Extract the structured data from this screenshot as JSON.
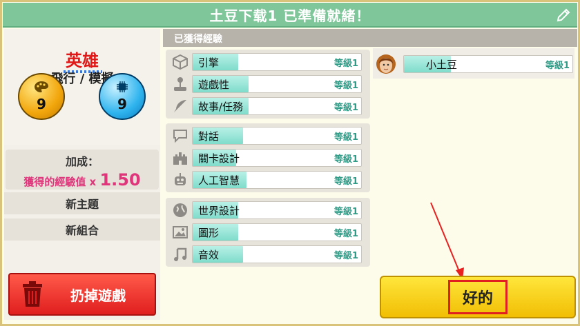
{
  "window": {
    "title": "土豆下载1 已準備就緒！"
  },
  "left": {
    "hero_text": "英雄",
    "genre": "飛行 / 模擬",
    "design_points": "9",
    "tech_points": "9",
    "bonus_label": "加成：",
    "bonus_text": "獲得的經驗值 x",
    "bonus_value": "1.50",
    "new_topic": "新主題",
    "new_combo": "新組合",
    "trash_label": "扔掉遊戲"
  },
  "experience": {
    "header": "已獲得經驗",
    "groups": [
      [
        {
          "icon": "engine-cube-icon",
          "name": "引擎",
          "level": "等級1",
          "progress": 0.27
        },
        {
          "icon": "joystick-icon",
          "name": "遊戲性",
          "level": "等級1",
          "progress": 0.33
        },
        {
          "icon": "quill-feather-icon",
          "name": "故事/任務",
          "level": "等級1",
          "progress": 0.33
        }
      ],
      [
        {
          "icon": "speech-bubble-icon",
          "name": "對話",
          "level": "等級1",
          "progress": 0.3
        },
        {
          "icon": "castle-icon",
          "name": "關卡設計",
          "level": "等級1",
          "progress": 0.26
        },
        {
          "icon": "robot-icon",
          "name": "人工智慧",
          "level": "等級1",
          "progress": 0.32
        }
      ],
      [
        {
          "icon": "globe-icon",
          "name": "世界設計",
          "level": "等級1",
          "progress": 0.27
        },
        {
          "icon": "picture-icon",
          "name": "圖形",
          "level": "等級1",
          "progress": 0.27
        },
        {
          "icon": "music-note-icon",
          "name": "音效",
          "level": "等級1",
          "progress": 0.3
        }
      ]
    ]
  },
  "staff": {
    "name": "小土豆",
    "level": "等級1",
    "progress": 0.28
  },
  "ok_button": "好的",
  "colors": {
    "title_bar": "#7fc79b",
    "exp_fill": "#7fdccb",
    "trash": "#e01e1e",
    "ok": "#f1be04",
    "highlight": "#e02020"
  }
}
